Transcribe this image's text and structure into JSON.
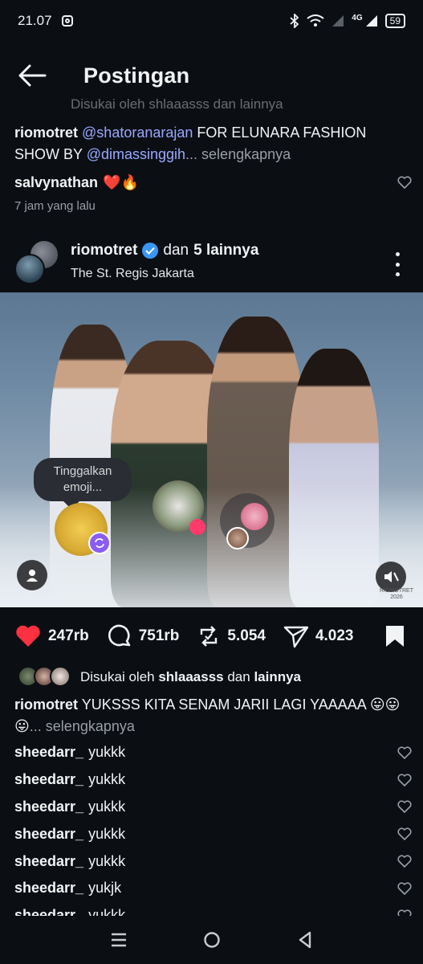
{
  "status_bar": {
    "time": "21.07",
    "network": "4G",
    "battery": "59",
    "icons": [
      "instagram-icon",
      "bluetooth-icon",
      "wifi-icon",
      "signal-icon",
      "battery-icon"
    ]
  },
  "header": {
    "title": "Postingan",
    "back_icon": "arrow-left-icon"
  },
  "previous_post": {
    "liked_by_text": "Disukai oleh shlaaasss dan lainnya",
    "caption_user": "riomotret",
    "caption_mention_1": "@shatoranarajan",
    "caption_text_1": " FOR ELUNARA FASHION SHOW BY ",
    "caption_mention_2": "@dimassinggih",
    "caption_ellipsis": "...",
    "more_label": "selengkapnya",
    "top_comment_user": "salvynathan",
    "top_comment_text": "❤️🔥",
    "time_ago": "7 jam yang lalu"
  },
  "post": {
    "username": "riomotret",
    "verified": true,
    "collab_text": "dan",
    "collab_count": "5 lainnya",
    "location": "The St. Regis Jakarta",
    "tooltip_text": "Tinggalkan emoji...",
    "watermark_1": "RIOMOTRET",
    "watermark_2": "2026",
    "likes": "247rb",
    "comments": "751rb",
    "reposts": "5.054",
    "shares": "4.023",
    "liked": true,
    "liked_prefix": "Disukai oleh ",
    "liked_user": "shlaaasss",
    "liked_mid": " dan ",
    "liked_suffix": "lainnya",
    "caption_user": "riomotret",
    "caption_text": " YUKSSS KITA SENAM JARII LAGI YAAAAA 😛😛😛",
    "caption_ellipsis": "...",
    "more_label": "selengkapnya"
  },
  "comments": [
    {
      "user": "sheedarr_",
      "text": "yukkk"
    },
    {
      "user": "sheedarr_",
      "text": "yukkk"
    },
    {
      "user": "sheedarr_",
      "text": "yukkk"
    },
    {
      "user": "sheedarr_",
      "text": "yukkk"
    },
    {
      "user": "sheedarr_",
      "text": "yukkk"
    },
    {
      "user": "sheedarr_",
      "text": "yukjk"
    },
    {
      "user": "sheedarr_",
      "text": "yukkk"
    }
  ],
  "colors": {
    "background": "#0b0f14",
    "like_red": "#ff3040",
    "mention_blue": "#9aa8ff",
    "verified_blue": "#3a96f6"
  }
}
